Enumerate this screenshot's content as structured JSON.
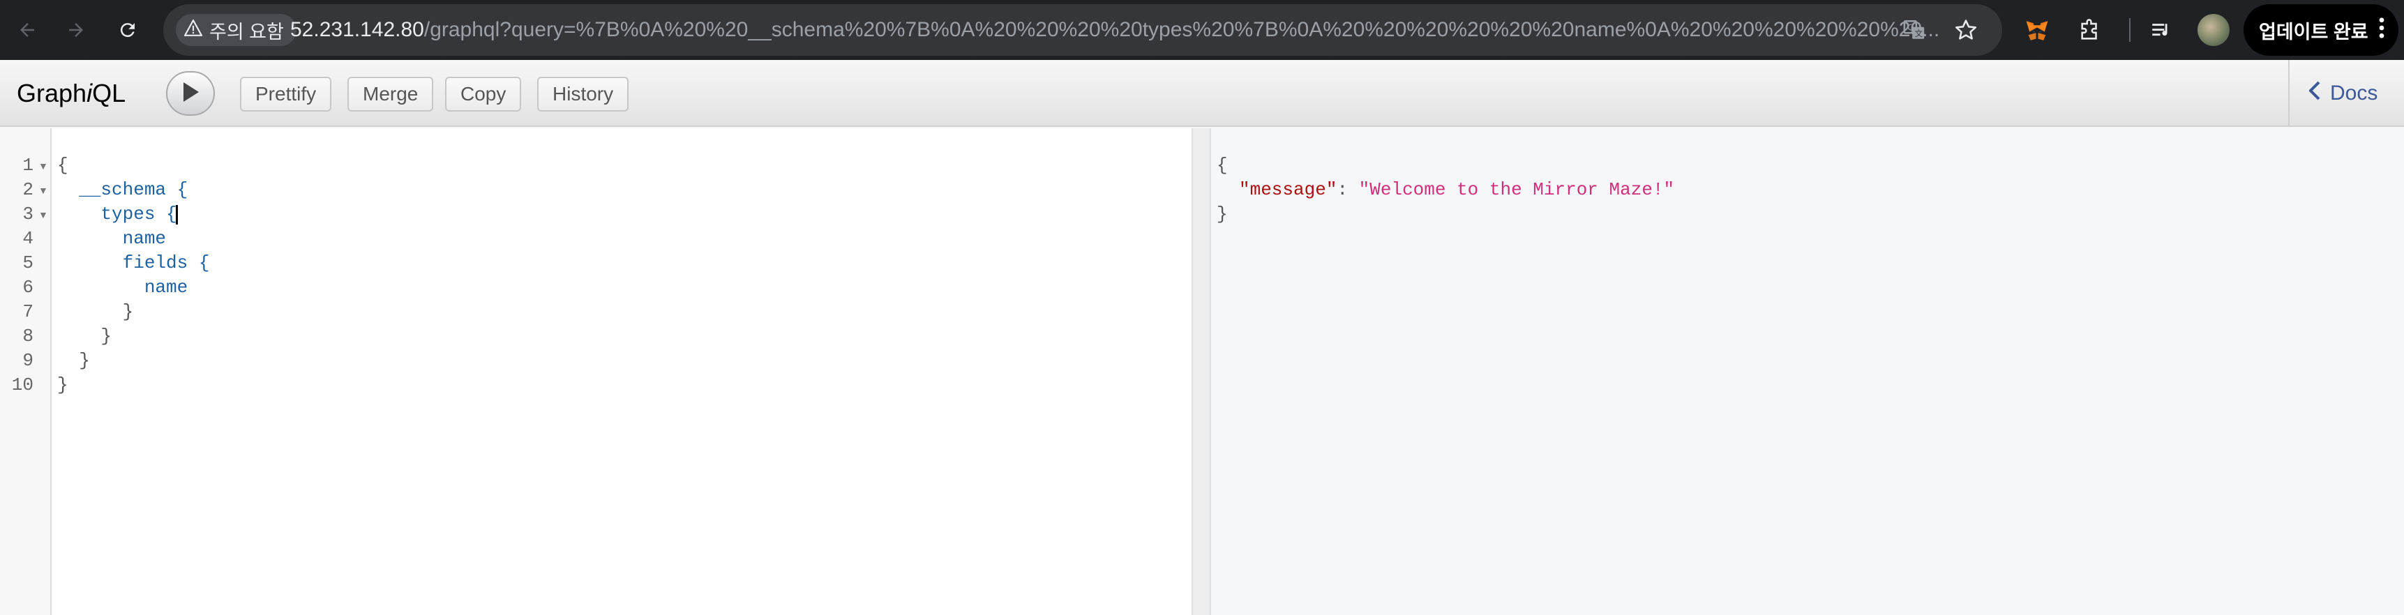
{
  "browser": {
    "security_label": "주의 요함",
    "url_host": "52.231.142.80",
    "url_rest": "/graphql?query=%7B%0A%20%20__schema%20%7B%0A%20%20%20%20types%20%7B%0A%20%20%20%20%20%20name%0A%20%20%20%20%20%20...",
    "update_label": "업데이트 완료",
    "icons": [
      "back-arrow-icon",
      "forward-arrow-icon",
      "reload-icon",
      "warning-icon",
      "translate-icon",
      "star-icon",
      "metamask-icon",
      "extensions-icon",
      "reading-list-icon",
      "profile-avatar",
      "more-vert-icon"
    ]
  },
  "toolbar": {
    "logo_prefix": "Graph",
    "logo_italic": "i",
    "logo_suffix": "QL",
    "run_icon": "play-icon",
    "buttons": [
      "Prettify",
      "Merge",
      "Copy",
      "History"
    ],
    "docs_label": "Docs"
  },
  "editor": {
    "line_numbers": [
      "1",
      "2",
      "3",
      "4",
      "5",
      "6",
      "7",
      "8",
      "9",
      "10"
    ],
    "lines": [
      "{",
      "  __schema {",
      "    types {",
      "      name",
      "      fields {",
      "        name",
      "      }",
      "    }",
      "  }",
      "}"
    ]
  },
  "result": {
    "open": "{",
    "key": "\"message\"",
    "colon": ": ",
    "value": "\"Welcome to the Mirror Maze!\"",
    "close": "}"
  },
  "colors": {
    "chrome_bg": "#202124",
    "keyword_blue": "#1f61a0",
    "json_key": "#aa1111",
    "json_string": "#d0307b",
    "docs_link": "#3b5998"
  }
}
